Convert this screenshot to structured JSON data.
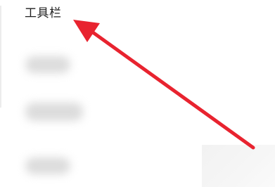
{
  "menu": {
    "title": "工具栏"
  },
  "annotation": {
    "arrow_color": "#e8232f"
  }
}
